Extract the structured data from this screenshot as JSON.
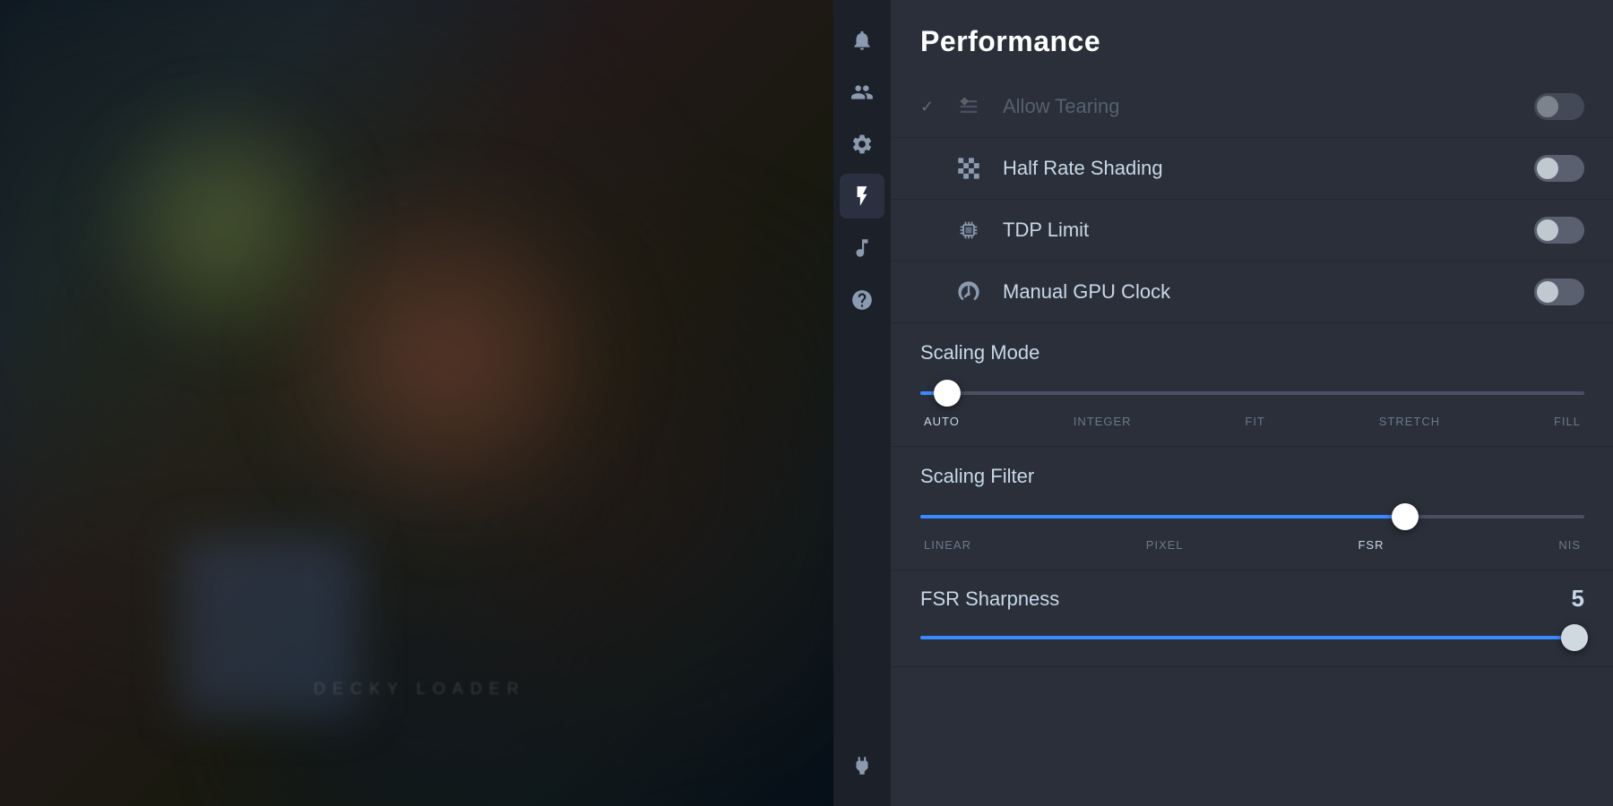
{
  "gameArea": {
    "blurText": "DECKY LOADER"
  },
  "sidebar": {
    "items": [
      {
        "name": "notifications",
        "icon": "bell",
        "active": false
      },
      {
        "name": "friends",
        "icon": "friends",
        "active": false
      },
      {
        "name": "settings",
        "icon": "gear",
        "active": false
      },
      {
        "name": "performance",
        "icon": "lightning",
        "active": true
      },
      {
        "name": "music",
        "icon": "music",
        "active": false
      },
      {
        "name": "help",
        "icon": "question",
        "active": false
      }
    ],
    "bottomItems": [
      {
        "name": "power",
        "icon": "plug",
        "active": false
      }
    ]
  },
  "panel": {
    "title": "Performance",
    "settings": [
      {
        "id": "allow-tearing",
        "icon": "tearing",
        "label": "Allow Tearing",
        "toggleState": "half-off",
        "hasCheckmark": true,
        "faded": true
      },
      {
        "id": "half-rate-shading",
        "icon": "shading",
        "label": "Half Rate Shading",
        "toggleState": "half-off",
        "hasCheckmark": false,
        "faded": false
      },
      {
        "id": "tdp-limit",
        "icon": "tdp",
        "label": "TDP Limit",
        "toggleState": "half-off",
        "hasCheckmark": false,
        "faded": false
      },
      {
        "id": "manual-gpu-clock",
        "icon": "gpu",
        "label": "Manual GPU Clock",
        "toggleState": "half-off",
        "hasCheckmark": false,
        "faded": false
      }
    ],
    "scalingMode": {
      "sectionLabel": "Scaling Mode",
      "options": [
        "AUTO",
        "INTEGER",
        "FIT",
        "STRETCH",
        "FILL"
      ],
      "activeIndex": 0,
      "sliderPosition": 4
    },
    "scalingFilter": {
      "sectionLabel": "Scaling Filter",
      "options": [
        "LINEAR",
        "PIXEL",
        "FSR",
        "NIS"
      ],
      "activeIndex": 2,
      "sliderPosition": 73
    },
    "fsrSharpness": {
      "label": "FSR Sharpness",
      "value": "5",
      "sliderPosition": 100
    }
  },
  "colors": {
    "accent": "#3a8aff",
    "toggleOff": "#4a5060",
    "toggleOn": "#4a9eff",
    "panelBg": "#2a2f3a",
    "sidebarBg": "#1c2028",
    "textPrimary": "#ffffff",
    "textSecondary": "#c8d8e8",
    "textMuted": "#6a7a8a"
  }
}
